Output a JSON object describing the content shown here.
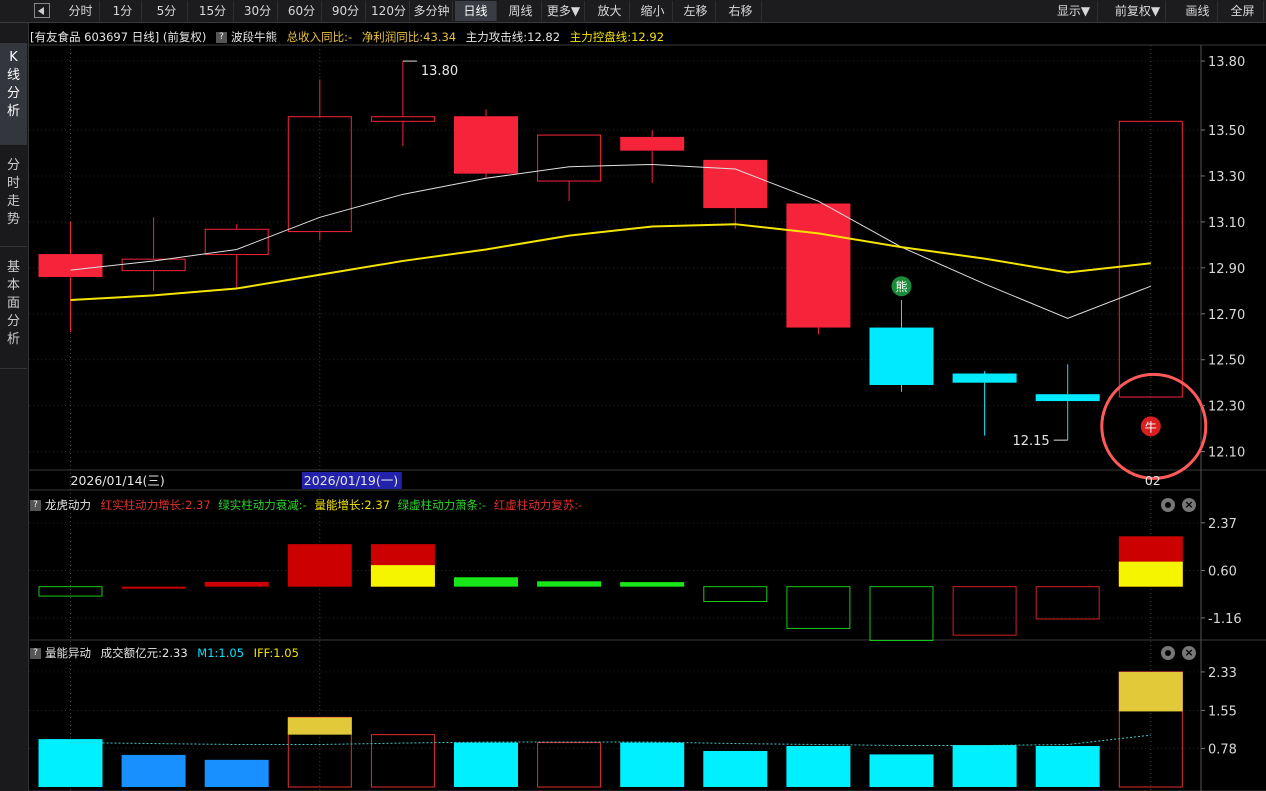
{
  "toolbar": {
    "buttons": [
      {
        "label": "分时",
        "active": false
      },
      {
        "label": "1分",
        "active": false
      },
      {
        "label": "5分",
        "active": false
      },
      {
        "label": "15分",
        "active": false
      },
      {
        "label": "30分",
        "active": false
      },
      {
        "label": "60分",
        "active": false
      },
      {
        "label": "90分",
        "active": false
      },
      {
        "label": "120分",
        "active": false
      },
      {
        "label": "多分钟",
        "active": false
      },
      {
        "label": "日线",
        "active": true
      },
      {
        "label": "周线",
        "active": false
      },
      {
        "label": "更多▼",
        "active": false
      },
      {
        "label": "放大",
        "active": false
      },
      {
        "label": "缩小",
        "active": false
      },
      {
        "label": "左移",
        "active": false
      },
      {
        "label": "右移",
        "active": false
      }
    ],
    "right_buttons": [
      {
        "label": "显示▼"
      },
      {
        "label": "前复权▼"
      },
      {
        "label": "画线"
      },
      {
        "label": "全屏"
      }
    ]
  },
  "sidebar": {
    "tabs": [
      {
        "label": "K线分析",
        "active": true
      },
      {
        "label": "分时走势",
        "active": false
      },
      {
        "label": "基本面分析",
        "active": false
      }
    ]
  },
  "header": {
    "stock": "[有友食品 603697 日线] (前复权)",
    "indicator_name": "波段牛熊",
    "items": [
      {
        "text": "总收入同比:-",
        "color": "#e8c03a"
      },
      {
        "text": "净利润同比:43.34",
        "color": "#e8c03a"
      },
      {
        "text": "主力攻击线:12.82",
        "color": "#e6e6e6"
      },
      {
        "text": "主力控盘线:12.92",
        "color": "#f5e400"
      }
    ]
  },
  "chart_data": [
    {
      "type": "candlestick",
      "title": "有友食品 603697 日线",
      "ylim": [
        12.02,
        13.87
      ],
      "y_ticks": [
        "13.80",
        "13.50",
        "13.30",
        "13.10",
        "12.90",
        "12.70",
        "12.50",
        "12.30",
        "12.10"
      ],
      "candles": [
        {
          "open": 12.96,
          "close": 12.86,
          "high": 13.1,
          "low": 12.62,
          "style": "red-solid"
        },
        {
          "open": 12.89,
          "close": 12.94,
          "high": 13.12,
          "low": 12.8,
          "style": "red-hollow"
        },
        {
          "open": 12.96,
          "close": 13.07,
          "high": 13.09,
          "low": 12.81,
          "style": "red-hollow"
        },
        {
          "open": 13.06,
          "close": 13.56,
          "high": 13.72,
          "low": 13.02,
          "style": "red-hollow"
        },
        {
          "open": 13.54,
          "close": 13.56,
          "high": 13.8,
          "low": 13.43,
          "style": "red-hollow"
        },
        {
          "open": 13.56,
          "close": 13.31,
          "high": 13.59,
          "low": 13.29,
          "style": "red-solid"
        },
        {
          "open": 13.28,
          "close": 13.48,
          "high": 13.48,
          "low": 13.19,
          "style": "red-hollow"
        },
        {
          "open": 13.47,
          "close": 13.41,
          "high": 13.5,
          "low": 13.27,
          "style": "red-solid"
        },
        {
          "open": 13.37,
          "close": 13.16,
          "high": 13.37,
          "low": 13.07,
          "style": "red-solid"
        },
        {
          "open": 13.18,
          "close": 12.64,
          "high": 13.18,
          "low": 12.61,
          "style": "red-solid"
        },
        {
          "open": 12.64,
          "close": 12.39,
          "high": 12.76,
          "low": 12.36,
          "style": "cyan-solid"
        },
        {
          "open": 12.44,
          "close": 12.4,
          "high": 12.45,
          "low": 12.17,
          "style": "cyan-solid"
        },
        {
          "open": 12.35,
          "close": 12.32,
          "high": 12.48,
          "low": 12.15,
          "style": "cyan-solid"
        },
        {
          "open": 12.34,
          "close": 13.54,
          "high": 13.54,
          "low": 12.34,
          "style": "red-hollow"
        }
      ],
      "series": [
        {
          "name": "主力攻击线",
          "color": "#e0e0e0",
          "values": [
            12.89,
            12.93,
            12.98,
            13.12,
            13.22,
            13.29,
            13.34,
            13.35,
            13.33,
            13.19,
            12.99,
            12.83,
            12.68,
            12.82
          ]
        },
        {
          "name": "主力控盘线",
          "color": "#f5e400",
          "values": [
            12.76,
            12.78,
            12.81,
            12.87,
            12.93,
            12.98,
            13.04,
            13.08,
            13.09,
            13.05,
            12.99,
            12.94,
            12.88,
            12.92
          ]
        }
      ],
      "annotations": [
        {
          "text": "13.80",
          "candle": 4,
          "value": 13.8
        },
        {
          "text": "12.15",
          "candle": 12,
          "value": 12.15
        },
        {
          "text": "熊",
          "candle": 10,
          "value": 12.82,
          "color": "#1a8c3a"
        },
        {
          "text": "牛",
          "candle": 13,
          "value": 12.21,
          "color": "#d81e1e"
        }
      ],
      "x_labels": [
        {
          "text": "2026/01/14(三)",
          "candle": 0
        },
        {
          "text": "2026/01/19(一)",
          "candle": 3,
          "highlighted": true
        },
        {
          "text": "02",
          "candle": 13
        }
      ]
    },
    {
      "type": "bar",
      "title": "龙虎动力",
      "legend": [
        {
          "text": "红实柱动力增长:2.37",
          "color": "#e0302c"
        },
        {
          "text": "绿实柱动力衰减:-",
          "color": "#2ed42e"
        },
        {
          "text": "量能增长:2.37",
          "color": "#f5e400"
        },
        {
          "text": "绿虚柱动力萧条:-",
          "color": "#2ed42e"
        },
        {
          "text": "红虚柱动力复苏:-",
          "color": "#e0302c"
        }
      ],
      "ylim": [
        -1.98,
        2.55
      ],
      "y_ticks": [
        "2.37",
        "0.60",
        "-1.16"
      ],
      "bars": [
        {
          "value": -0.35,
          "style": "green-hollow"
        },
        {
          "value": -0.05,
          "style": "red-solid"
        },
        {
          "value": 0.18,
          "style": "red-solid"
        },
        {
          "value": 1.58,
          "style": "red-solid"
        },
        {
          "value": 1.58,
          "style": "red-yellow",
          "yellow": 0.8
        },
        {
          "value": 0.35,
          "style": "green-solid"
        },
        {
          "value": 0.2,
          "style": "green-solid"
        },
        {
          "value": 0.17,
          "style": "green-solid"
        },
        {
          "value": -0.55,
          "style": "green-hollow"
        },
        {
          "value": -1.55,
          "style": "green-hollow"
        },
        {
          "value": -2.0,
          "style": "green-hollow"
        },
        {
          "value": -1.8,
          "style": "red-hollow"
        },
        {
          "value": -1.2,
          "style": "red-hollow"
        },
        {
          "value": 1.87,
          "style": "red-yellow",
          "yellow": 0.93
        }
      ]
    },
    {
      "type": "bar",
      "title": "量能异动",
      "legend": [
        {
          "text": "成交额亿元:2.33",
          "color": "#e6e6e6"
        },
        {
          "text": "M1:1.05",
          "color": "#00e5ff"
        },
        {
          "text": "IFF:1.05",
          "color": "#f5e400"
        }
      ],
      "ylim": [
        0.0,
        2.45
      ],
      "y_ticks": [
        "2.33",
        "1.55",
        "0.78"
      ],
      "bars": [
        {
          "value": 0.97,
          "style": "cyan-solid"
        },
        {
          "value": 0.65,
          "style": "blue-solid"
        },
        {
          "value": 0.55,
          "style": "blue-solid"
        },
        {
          "value": 1.41,
          "style": "red-hollow",
          "top_yellow": 0.35
        },
        {
          "value": 1.06,
          "style": "red-hollow"
        },
        {
          "value": 0.9,
          "style": "cyan-solid"
        },
        {
          "value": 0.9,
          "style": "red-hollow"
        },
        {
          "value": 0.9,
          "style": "cyan-solid"
        },
        {
          "value": 0.73,
          "style": "cyan-solid"
        },
        {
          "value": 0.83,
          "style": "cyan-solid"
        },
        {
          "value": 0.66,
          "style": "cyan-solid"
        },
        {
          "value": 0.85,
          "style": "cyan-solid"
        },
        {
          "value": 0.83,
          "style": "cyan-solid"
        },
        {
          "value": 2.33,
          "style": "red-hollow",
          "top_yellow": 0.8
        }
      ],
      "m1_line": [
        0.9,
        0.88,
        0.86,
        0.86,
        0.89,
        0.91,
        0.91,
        0.91,
        0.88,
        0.86,
        0.84,
        0.84,
        0.86,
        1.05
      ]
    }
  ]
}
